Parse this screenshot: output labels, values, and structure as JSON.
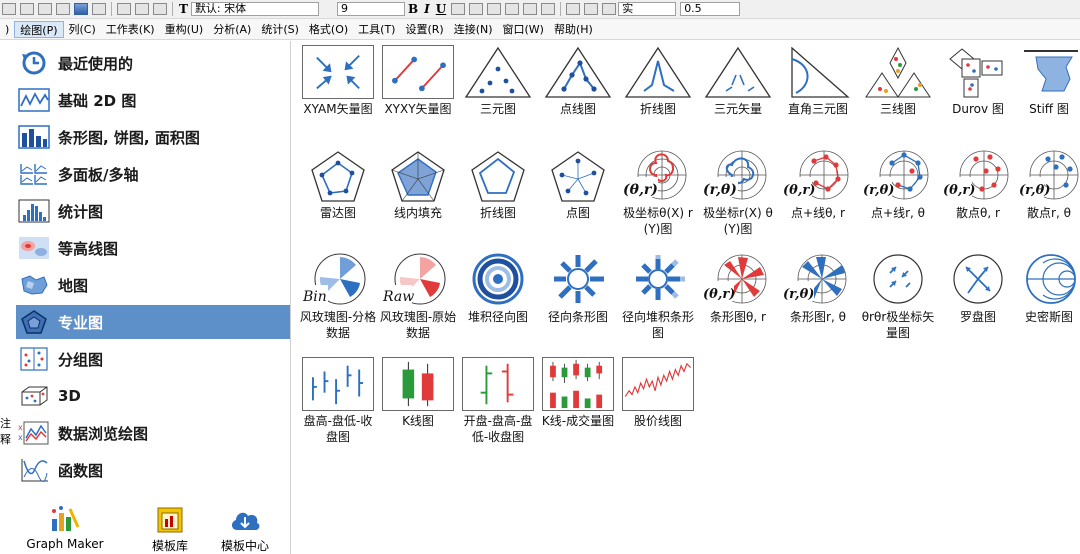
{
  "toolbar": {
    "font_label": "默认: 宋体",
    "font_size": "9",
    "bold": "B",
    "italic": "I",
    "underline": "U",
    "line_style": "实",
    "line_width": "0.5"
  },
  "menu": {
    "items": [
      {
        "label": "绘图(P)"
      },
      {
        "label": "列(C)"
      },
      {
        "label": "工作表(K)"
      },
      {
        "label": "重构(U)"
      },
      {
        "label": "分析(A)"
      },
      {
        "label": "统计(S)"
      },
      {
        "label": "格式(O)"
      },
      {
        "label": "工具(T)"
      },
      {
        "label": "设置(R)"
      },
      {
        "label": "连接(N)"
      },
      {
        "label": "窗口(W)"
      },
      {
        "label": "帮助(H)"
      }
    ]
  },
  "left_strip": {
    "fragment": "注释"
  },
  "categories": [
    {
      "label": "最近使用的",
      "icon": "recent-clock-icon"
    },
    {
      "label": "基础 2D 图",
      "icon": "line-chart-icon"
    },
    {
      "label": "条形图, 饼图, 面积图",
      "icon": "bar-chart-icon"
    },
    {
      "label": "多面板/多轴",
      "icon": "multi-panel-icon"
    },
    {
      "label": "统计图",
      "icon": "histogram-icon"
    },
    {
      "label": "等高线图",
      "icon": "contour-icon"
    },
    {
      "label": "地图",
      "icon": "map-icon"
    },
    {
      "label": "专业图",
      "icon": "specialized-pentagon-icon"
    },
    {
      "label": "分组图",
      "icon": "grouped-plot-icon"
    },
    {
      "label": "3D",
      "icon": "3d-cube-icon"
    },
    {
      "label": "数据浏览绘图",
      "icon": "data-explore-icon"
    },
    {
      "label": "函数图",
      "icon": "function-plot-icon"
    }
  ],
  "selected_category": "专业图",
  "bottom_tools": [
    {
      "label": "Graph Maker",
      "icon": "graph-maker-icon"
    },
    {
      "label": "模板库",
      "icon": "template-library-icon"
    },
    {
      "label": "模板中心",
      "icon": "template-center-cloud-icon"
    }
  ],
  "templates": {
    "row1": [
      "XYAM矢量图",
      "XYXY矢量图",
      "三元图",
      "点线图",
      "折线图",
      "三元矢量",
      "直角三元图",
      "三线图",
      "Durov 图",
      "Stiff 图"
    ],
    "row2": [
      "雷达图",
      "线内填充",
      "折线图",
      "点图",
      "极坐标θ(X) r(Y)图",
      "极坐标r(X) θ(Y)图",
      "点+线θ, r",
      "点+线r, θ",
      "散点θ, r",
      "散点r, θ"
    ],
    "row3": [
      "风玫瑰图-分格数据",
      "风玫瑰图-原始数据",
      "堆积径向图",
      "径向条形图",
      "径向堆积条形图",
      "条形图θ, r",
      "条形图r, θ",
      "θrθr极坐标矢量图",
      "罗盘图",
      "史密斯图"
    ],
    "row4": [
      "盘高-盘低-收盘图",
      "K线图",
      "开盘-盘高-盘低-收盘图",
      "K线-成交量图",
      "股价线图"
    ]
  },
  "thumb_text": {
    "polar_theta_r": "(θ,r)",
    "polar_r_theta": "(r,θ)",
    "bin": "Bin",
    "raw": "Raw"
  },
  "colors": {
    "selection": "#5d8fc9",
    "accent_blue": "#2f6fc0",
    "accent_red": "#e03a3a",
    "accent_green": "#2a9a3a"
  }
}
